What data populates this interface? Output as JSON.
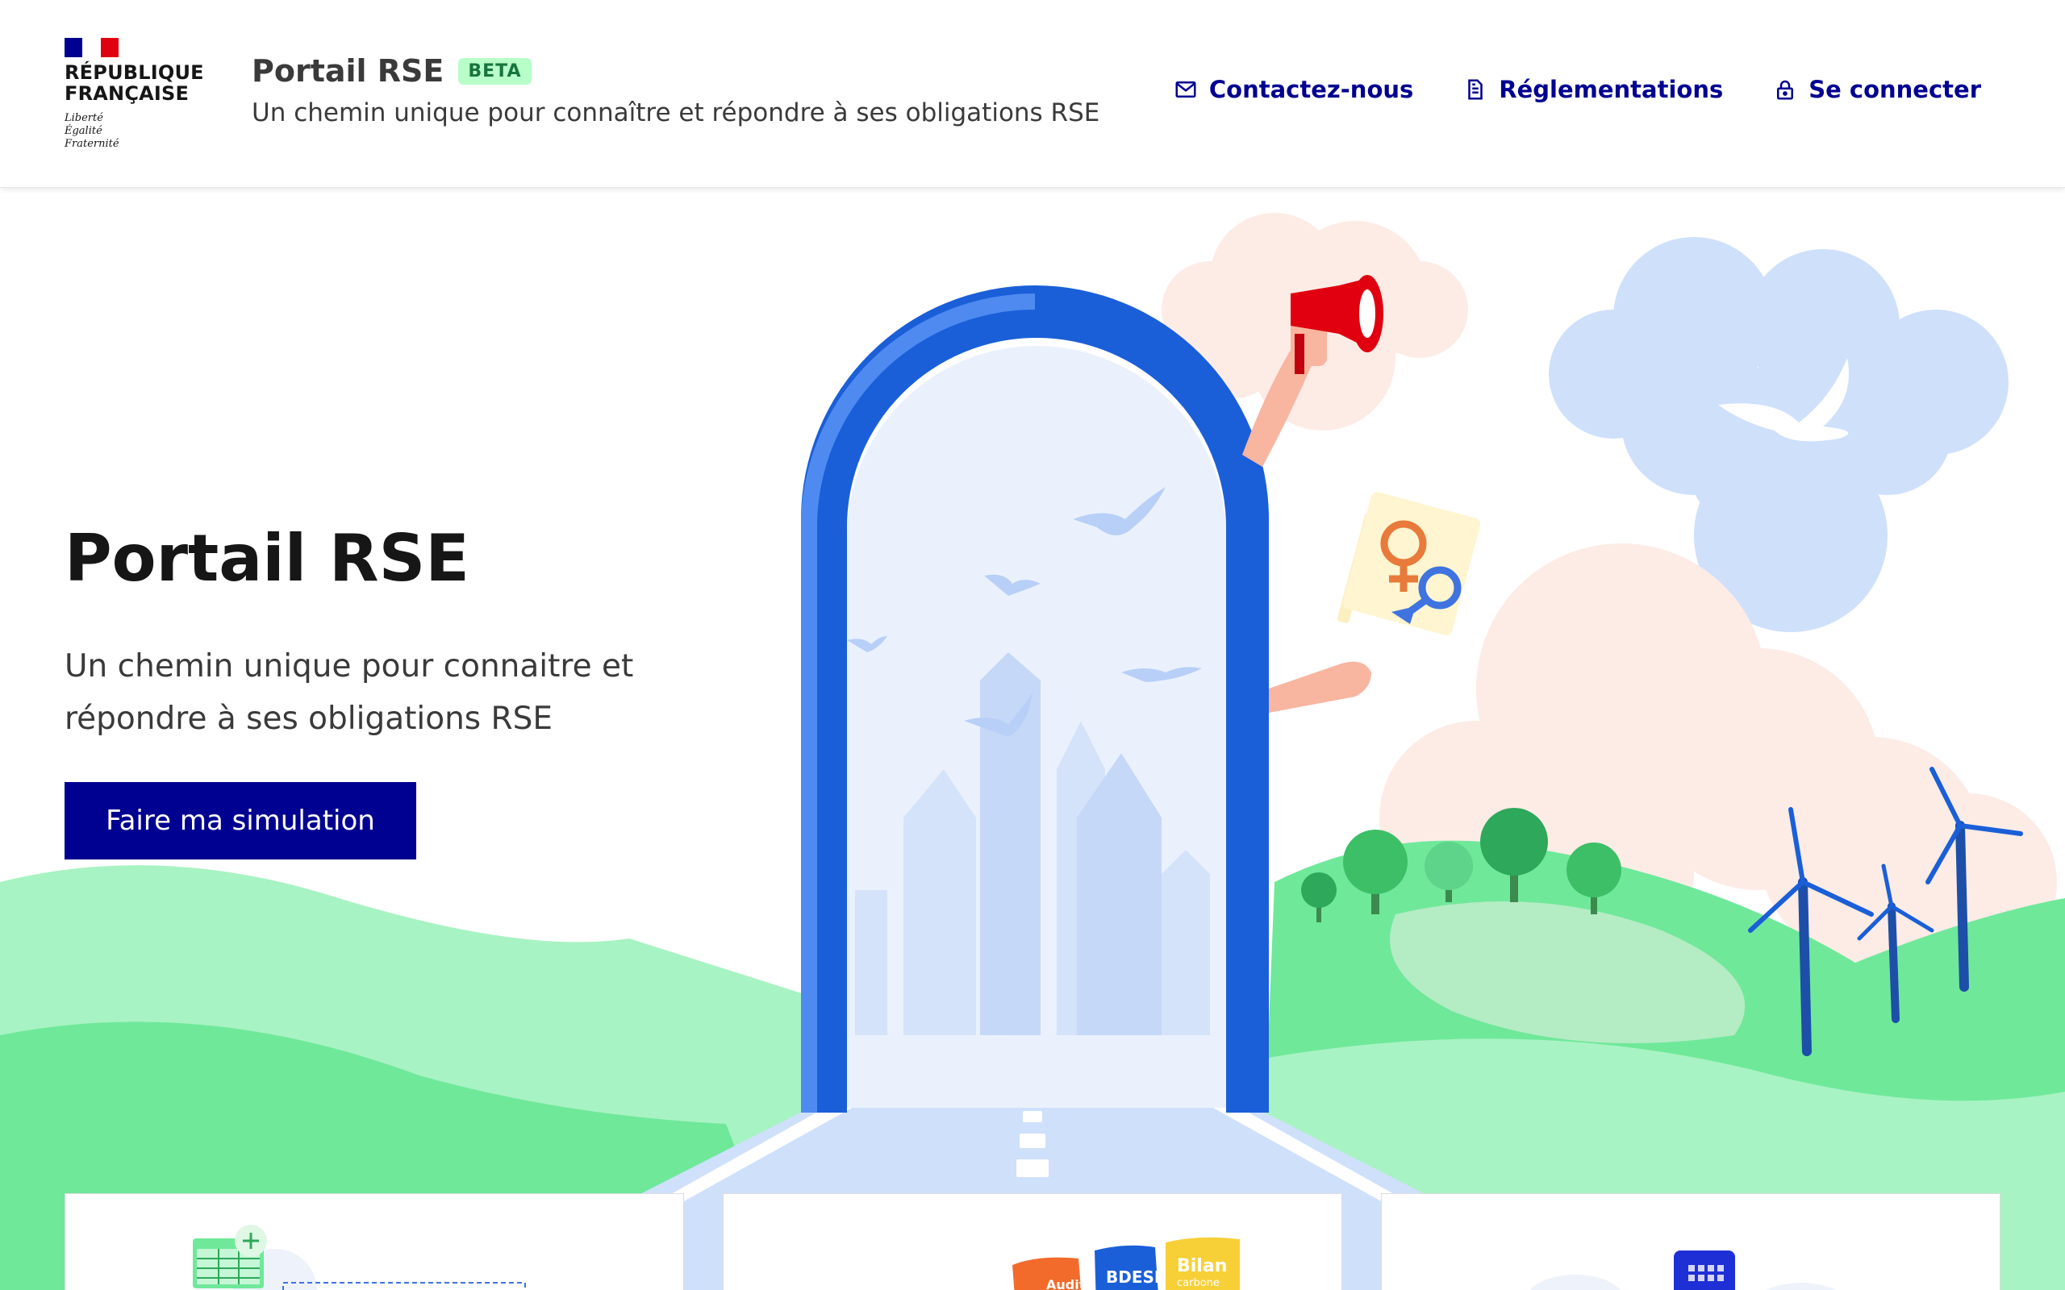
{
  "header": {
    "logo": {
      "republique": "RÉPUBLIQUE",
      "francaise": "FRANÇAISE",
      "motto": [
        "Liberté",
        "Égalité",
        "Fraternité"
      ]
    },
    "service_title": "Portail RSE",
    "badge": "BETA",
    "tagline": "Un chemin unique pour connaître et répondre à ses obligations RSE",
    "nav": [
      {
        "label": "Contactez-nous",
        "icon": "mail-icon"
      },
      {
        "label": "Réglementations",
        "icon": "document-icon"
      },
      {
        "label": "Se connecter",
        "icon": "lock-icon"
      }
    ]
  },
  "hero": {
    "title": "Portail RSE",
    "subtitle": "Un chemin unique pour connaitre et répondre à ses obligations RSE",
    "cta_label": "Faire ma simulation"
  },
  "cards": {
    "labels": [
      "Audit",
      "BDESE",
      "Bilan",
      "carbone"
    ]
  },
  "colors": {
    "primary": "#000091",
    "badge_bg": "#b8fec9",
    "badge_text": "#18753c",
    "grass": "#6fe89a",
    "grass_light": "#a8f3c3",
    "arch": "#1a5fd8",
    "sky_blue": "#cfe0fb",
    "cloud_pink": "#fdece6"
  }
}
